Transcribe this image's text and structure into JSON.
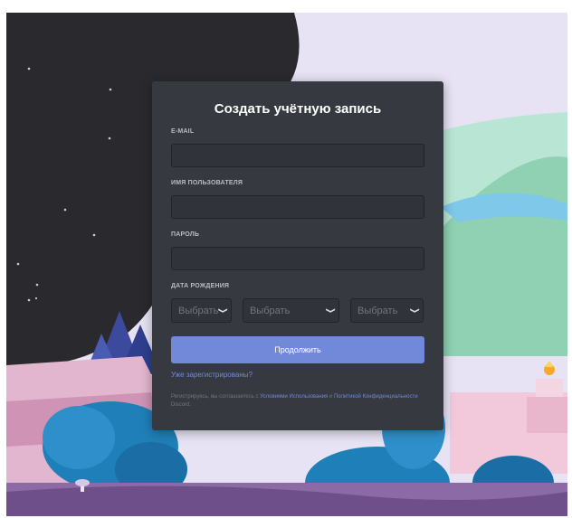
{
  "form": {
    "title": "Создать учётную запись",
    "email_label": "E-MAIL",
    "username_label": "ИМЯ ПОЛЬЗОВАТЕЛЯ",
    "password_label": "ПАРОЛЬ",
    "dob_label": "ДАТА РОЖДЕНИЯ",
    "day_select": "Выбрать",
    "month_select": "Выбрать",
    "year_select": "Выбрать",
    "continue_button": "Продолжить",
    "login_link": "Уже зарегистрированы?",
    "legal": {
      "prefix": "Регистрируясь, вы соглашаетесь с ",
      "terms_link": "Условиями Использования",
      "and": " и ",
      "privacy_link": "Политикой Конфиденциальности",
      "suffix": " Discord."
    }
  },
  "colors": {
    "card_bg": "#36393f",
    "input_bg": "#303339",
    "accent": "#7289da",
    "label": "#b9bbbe"
  },
  "icons": [
    "chevron-down-icon"
  ]
}
